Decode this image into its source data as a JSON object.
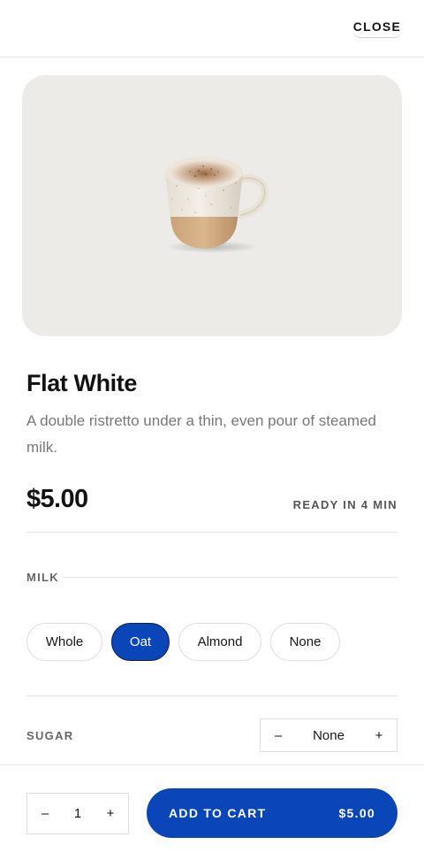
{
  "header": {
    "close_label": "CLOSE"
  },
  "product": {
    "name": "Flat White",
    "description": "A double ristretto under a thin, even pour of steamed milk.",
    "price": "$5.00",
    "ready_time": "READY IN 4 MIN",
    "image_icon": "coffee-cup-image"
  },
  "milk": {
    "label": "MILK",
    "options": [
      "Whole",
      "Oat",
      "Almond",
      "None"
    ],
    "selected": "Oat"
  },
  "sugar": {
    "label": "SUGAR",
    "value": "None",
    "decrement": "–",
    "increment": "+"
  },
  "cart": {
    "quantity": "1",
    "decrement": "–",
    "increment": "+",
    "add_label": "ADD TO CART",
    "total": "$5.00"
  },
  "colors": {
    "accent": "#0a46b8",
    "hero_bg": "#edebe8",
    "muted_text": "#777777"
  }
}
